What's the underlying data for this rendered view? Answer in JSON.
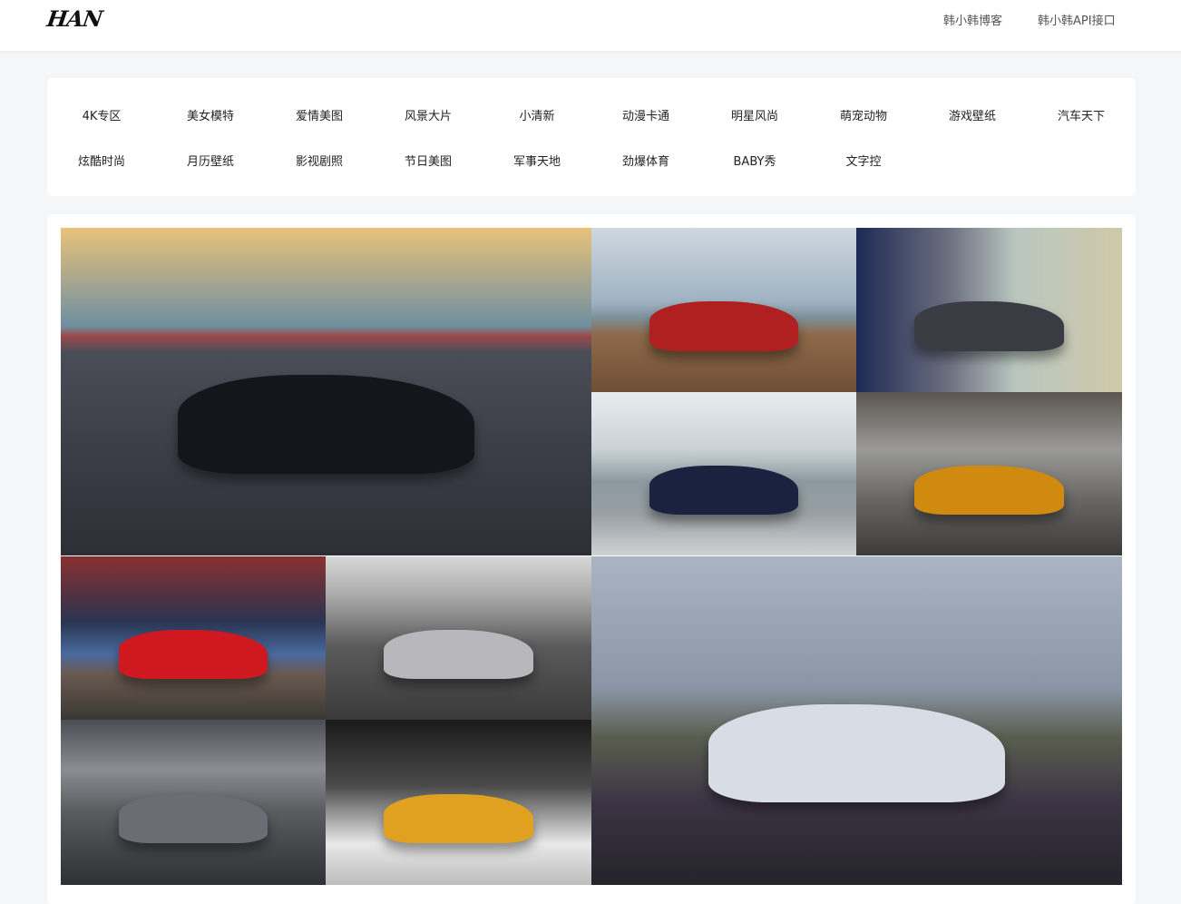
{
  "header": {
    "logo": "HAN",
    "nav": [
      {
        "label": "韩小韩博客"
      },
      {
        "label": "韩小韩API接口"
      }
    ]
  },
  "categories": [
    "4K专区",
    "美女模特",
    "爱情美图",
    "风景大片",
    "小清新",
    "动漫卡通",
    "明星风尚",
    "萌宠动物",
    "游戏壁纸",
    "汽车天下",
    "炫酷时尚",
    "月历壁纸",
    "影视剧照",
    "节日美图",
    "军事天地",
    "劲爆体育",
    "BABY秀",
    "文字控"
  ],
  "gallery": [
    {
      "name": "black-sports-car-sunset",
      "sky": "linear-gradient(180deg,#e8c27a 0%,#6f8fa0 30%,#9a4a4a 33%,#4a4d57 38%,#2d2f36 100%)",
      "car": "#14161c"
    },
    {
      "name": "beach-red-car",
      "sky": "linear-gradient(180deg,#cfd8e0 0%,#9fb3c2 45%,#7c8f98 55%,#8e6a4a 65%,#6e4f35 100%)",
      "car": "#b02020"
    },
    {
      "name": "wheel-closeup",
      "sky": "linear-gradient(90deg,#1e2a55 0%,#6d7080 35%,#b9c7c0 60%,#cfc9a8 100%)",
      "car": "#3a3c44"
    },
    {
      "name": "f1-car-harbor",
      "sky": "linear-gradient(180deg,#e8ecef 0%,#c9d2d6 35%,#8c9aa0 55%,#9aa0a4 75%,#cfd2d4 100%)",
      "car": "#1a2240"
    },
    {
      "name": "orange-mustang-underpass",
      "sky": "linear-gradient(180deg,#5a5550 0%,#9a9a98 35%,#6a6864 65%,#3c3b3a 100%)",
      "car": "#d08a10"
    },
    {
      "name": "red-car-planet",
      "sky": "linear-gradient(180deg,#8a3030 0%,#2a3450 40%,#4a6aa0 60%,#6a5a50 72%,#3a3834 100%)",
      "car": "#d01820"
    },
    {
      "name": "silver-supercar-hangar",
      "sky": "linear-gradient(180deg,#d8d8d8 0%,#a8a8a8 25%,#5a5a5a 55%,#3a3a3a 100%)",
      "car": "#b8b8bc"
    },
    {
      "name": "white-mustang-flowers",
      "sky": "linear-gradient(180deg,#aab4c2 0%,#8a96a6 40%,#5a5e50 55%,#3c3444 75%,#24242a 100%)",
      "car": "#d8dce4"
    },
    {
      "name": "grey-mclaren-track",
      "sky": "linear-gradient(180deg,#4a4e54 0%,#8a8e92 30%,#5a5c60 55%,#2e3034 100%)",
      "car": "#6a6e74"
    },
    {
      "name": "yellow-mclaren-studio",
      "sky": "linear-gradient(180deg,#1a1a1a 0%,#4a4a4a 40%,#e8e8e8 75%,#bdbdbd 100%)",
      "car": "#e0a020"
    }
  ]
}
